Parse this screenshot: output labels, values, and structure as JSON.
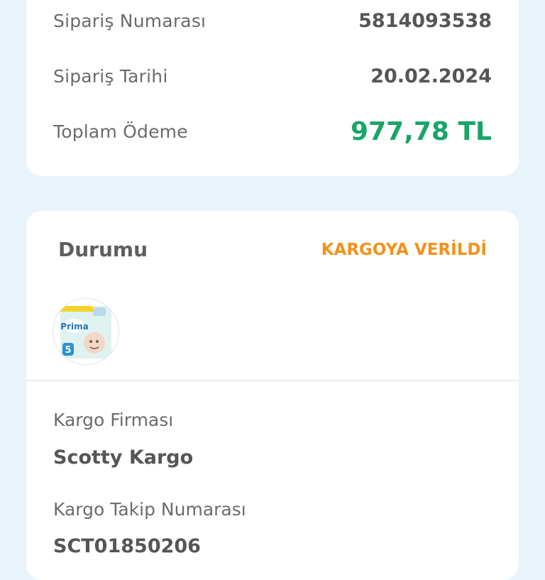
{
  "order": {
    "number_label": "Sipariş Numarası",
    "number_value": "5814093538",
    "date_label": "Sipariş Tarihi",
    "date_value": "20.02.2024",
    "total_label": "Toplam Ödeme",
    "total_value": "977,78 TL"
  },
  "status": {
    "title": "Durumu",
    "value": "KARGOYA VERİLDİ",
    "product_icon": "diaper-package-icon",
    "product_brand_text": "Prima",
    "product_size": "5"
  },
  "shipping": {
    "company_label": "Kargo Firması",
    "company_value": "Scotty Kargo",
    "tracking_label": "Kargo Takip Numarası",
    "tracking_value": "SCT01850206"
  },
  "colors": {
    "background": "#e8f3fa",
    "card": "#ffffff",
    "total_green": "#1aa568",
    "status_orange": "#f5901a",
    "label_gray": "#6b6b6b",
    "value_gray": "#555555"
  }
}
